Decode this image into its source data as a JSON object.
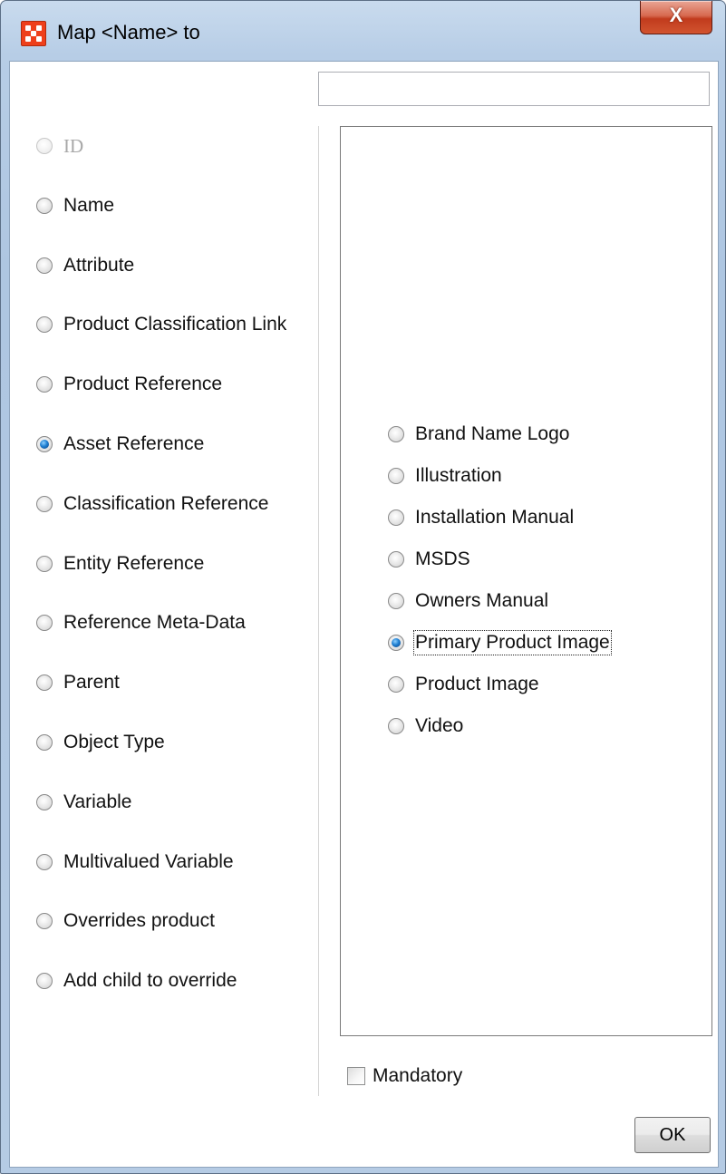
{
  "window": {
    "title": "Map <Name> to",
    "close_label": "X"
  },
  "search": {
    "value": ""
  },
  "left_options": [
    {
      "label": "ID",
      "checked": false,
      "disabled": true
    },
    {
      "label": "Name",
      "checked": false,
      "disabled": false
    },
    {
      "label": "Attribute",
      "checked": false,
      "disabled": false
    },
    {
      "label": "Product Classification Link",
      "checked": false,
      "disabled": false
    },
    {
      "label": "Product Reference",
      "checked": false,
      "disabled": false
    },
    {
      "label": "Asset Reference",
      "checked": true,
      "disabled": false
    },
    {
      "label": "Classification Reference",
      "checked": false,
      "disabled": false
    },
    {
      "label": "Entity Reference",
      "checked": false,
      "disabled": false
    },
    {
      "label": "Reference Meta-Data",
      "checked": false,
      "disabled": false
    },
    {
      "label": "Parent",
      "checked": false,
      "disabled": false
    },
    {
      "label": "Object Type",
      "checked": false,
      "disabled": false
    },
    {
      "label": "Variable",
      "checked": false,
      "disabled": false
    },
    {
      "label": "Multivalued Variable",
      "checked": false,
      "disabled": false
    },
    {
      "label": "Overrides product",
      "checked": false,
      "disabled": false
    },
    {
      "label": "Add child to override",
      "checked": false,
      "disabled": false
    }
  ],
  "right_options": [
    {
      "label": "Brand Name Logo",
      "checked": false
    },
    {
      "label": "Illustration",
      "checked": false
    },
    {
      "label": "Installation Manual",
      "checked": false
    },
    {
      "label": "MSDS",
      "checked": false
    },
    {
      "label": "Owners Manual",
      "checked": false
    },
    {
      "label": "Primary Product Image",
      "checked": true
    },
    {
      "label": "Product Image",
      "checked": false
    },
    {
      "label": "Video",
      "checked": false
    }
  ],
  "mandatory": {
    "label": "Mandatory",
    "checked": false
  },
  "buttons": {
    "ok_label": "OK"
  }
}
